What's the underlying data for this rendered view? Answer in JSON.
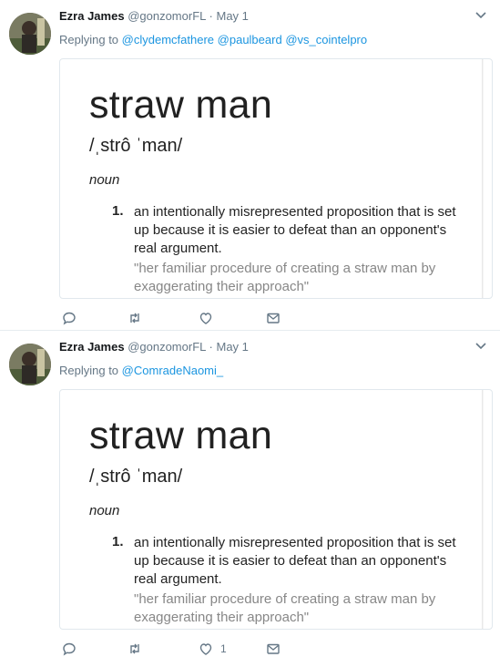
{
  "tweets": [
    {
      "author_name": "Ezra James",
      "handle": "@gonzomorFL",
      "separator": "·",
      "date": "May 1",
      "replying_to_label": "Replying to",
      "mentions": [
        "@clydemcfathere",
        "@paulbeard",
        "@vs_cointelpro"
      ],
      "card": {
        "word": "straw man",
        "pronunciation": "/ˌstrô ˈman/",
        "part_of_speech": "noun",
        "number": "1.",
        "definition": "an intentionally misrepresented proposition that is set up because it is easier to defeat than an opponent's real argument.",
        "example": "\"her familiar procedure of creating a straw man by exaggerating their approach\""
      },
      "actions": {
        "reply_count": "",
        "retweet_count": "",
        "like_count": ""
      }
    },
    {
      "author_name": "Ezra James",
      "handle": "@gonzomorFL",
      "separator": "·",
      "date": "May 1",
      "replying_to_label": "Replying to",
      "mentions": [
        "@ComradeNaomi_"
      ],
      "card": {
        "word": "straw man",
        "pronunciation": "/ˌstrô ˈman/",
        "part_of_speech": "noun",
        "number": "1.",
        "definition": "an intentionally misrepresented proposition that is set up because it is easier to defeat than an opponent's real argument.",
        "example": "\"her familiar procedure of creating a straw man by exaggerating their approach\""
      },
      "actions": {
        "reply_count": "",
        "retweet_count": "",
        "like_count": "1"
      }
    }
  ],
  "colors": {
    "link": "#1b95e0",
    "muted": "#657786",
    "text": "#14171a",
    "border": "#e1e8ed"
  },
  "icons": [
    "caret-down-icon",
    "reply-icon",
    "retweet-icon",
    "like-icon",
    "dm-icon"
  ]
}
